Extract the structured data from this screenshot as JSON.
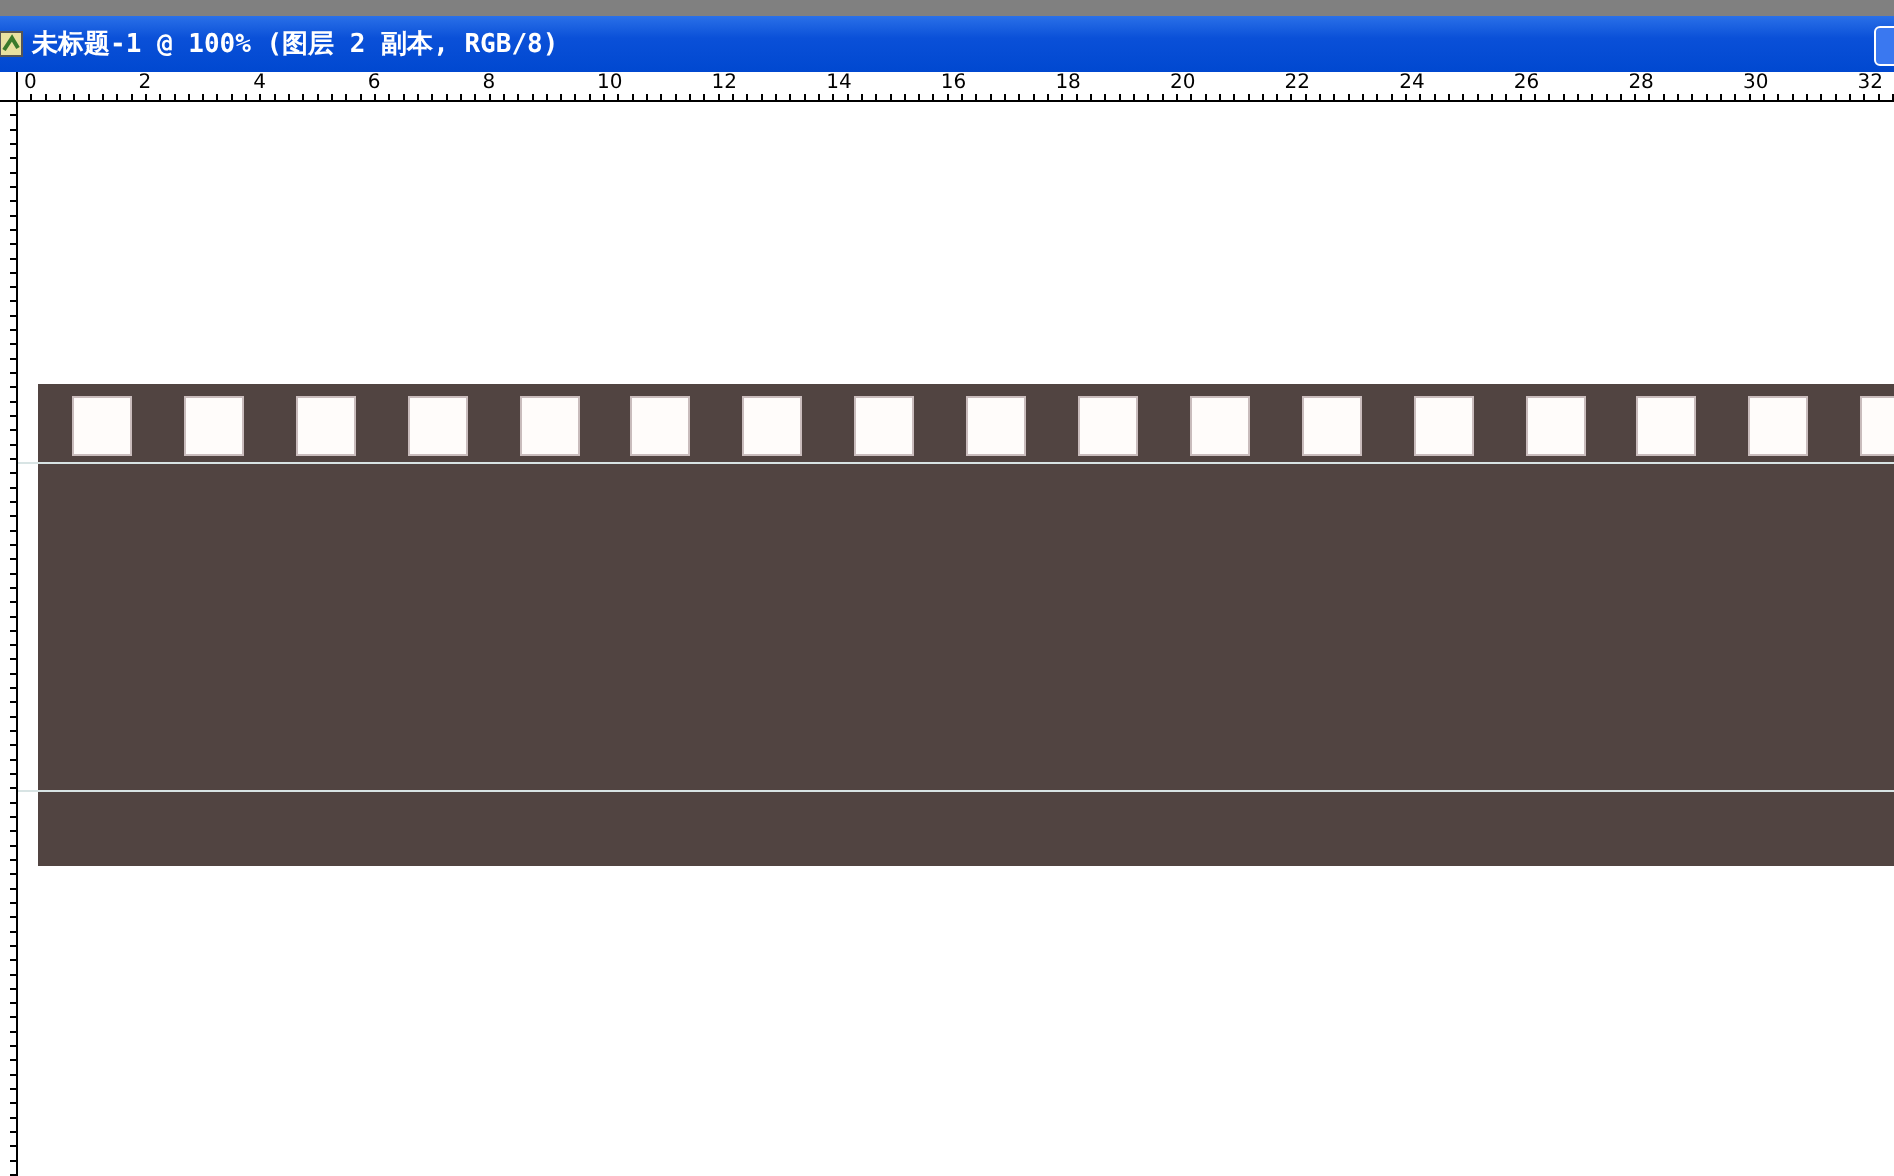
{
  "window": {
    "title": "未标题-1 @ 100% (图层 2 副本, RGB/8)"
  },
  "ruler": {
    "labels": [
      "0",
      "2",
      "4",
      "6",
      "8",
      "10",
      "12",
      "14",
      "16",
      "18",
      "20",
      "22",
      "24",
      "26",
      "28",
      "30",
      "32"
    ]
  }
}
